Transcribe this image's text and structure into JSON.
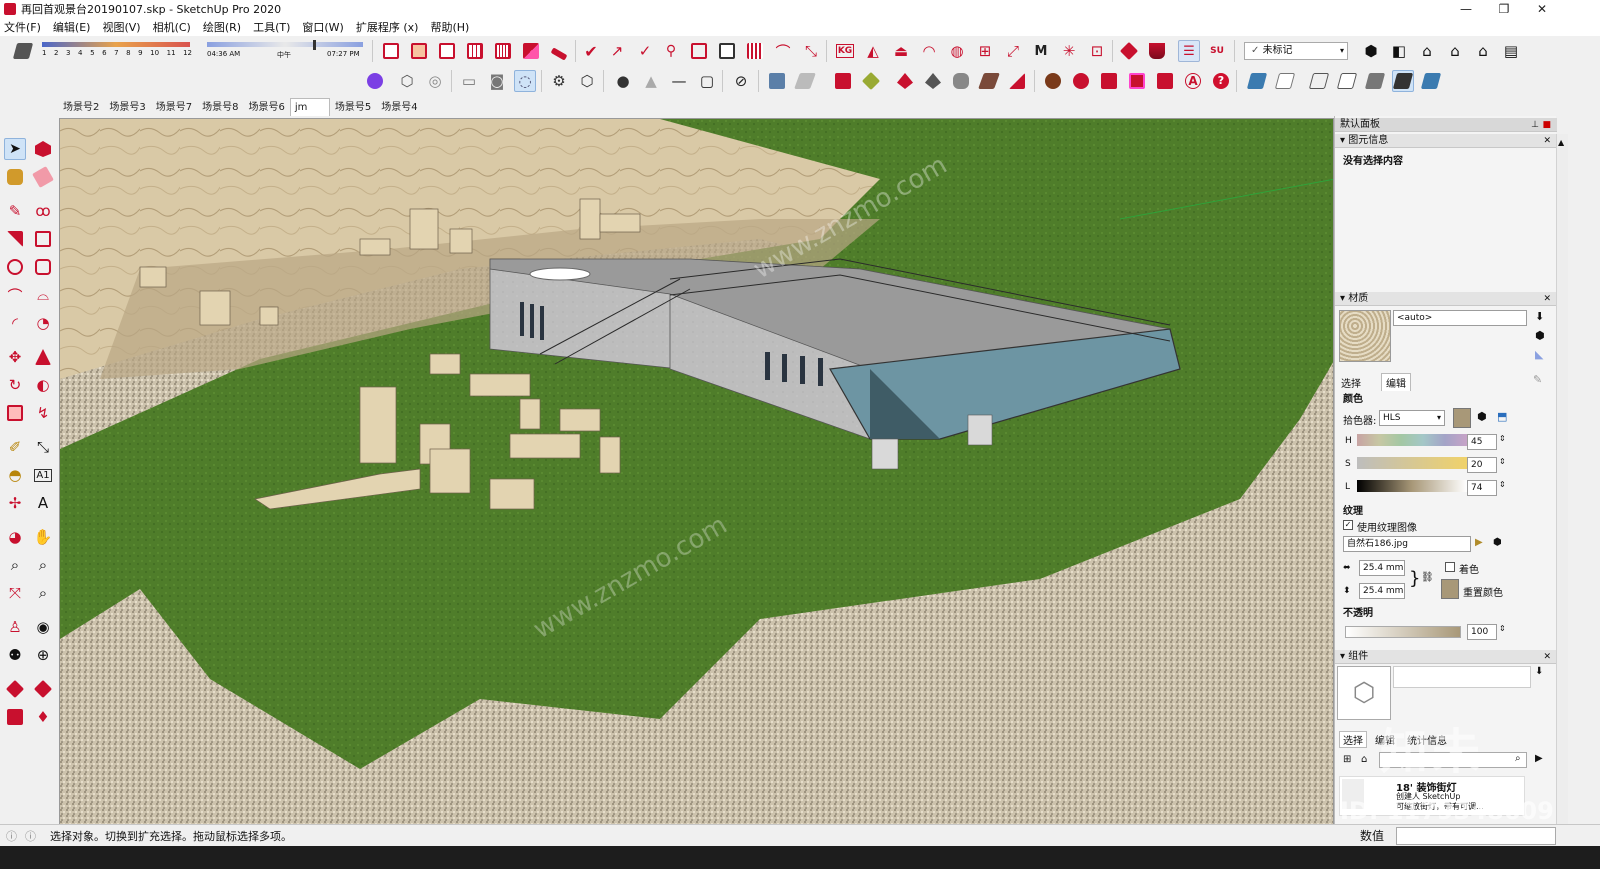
{
  "window": {
    "title": "再回首观景台20190107.skp - SketchUp Pro 2020",
    "minimize": "—",
    "maximize": "❐",
    "close": "✕"
  },
  "menu": [
    "文件(F)",
    "编辑(E)",
    "视图(V)",
    "相机(C)",
    "绘图(R)",
    "工具(T)",
    "窗口(W)",
    "扩展程序 (x)",
    "帮助(H)"
  ],
  "shadow": {
    "months": [
      "1",
      "2",
      "3",
      "4",
      "5",
      "6",
      "7",
      "8",
      "9",
      "10",
      "11",
      "12"
    ],
    "time_start": "04:36 AM",
    "time_mid": "中午",
    "time_end": "07:27 PM"
  },
  "tag_select": {
    "value": "未标记"
  },
  "scenes": {
    "tabs": [
      "场景号2",
      "场景号3",
      "场景号7",
      "场景号8",
      "场景号6",
      "jm",
      "场景号5",
      "场景号4"
    ],
    "active_index": 5
  },
  "panel": {
    "title": "默认面板",
    "entity_info": {
      "header": "图元信息",
      "none_selected": "没有选择内容"
    },
    "materials": {
      "header": "材质",
      "name_value": "<auto>",
      "tab_select": "选择",
      "tab_edit": "编辑",
      "color_label": "颜色",
      "picker_label": "拾色器:",
      "picker_value": "HLS",
      "swatch_color": "#a89878",
      "h_label": "H",
      "h_value": "45",
      "s_label": "S",
      "s_value": "20",
      "l_label": "L",
      "l_value": "74",
      "texture_label": "纹理",
      "use_texture_label": "使用纹理图像",
      "texture_file": "自然石186.jpg",
      "width_value": "25.4 mm",
      "height_value": "25.4 mm",
      "colorize_label": "着色",
      "reset_color_label": "重置颜色",
      "opacity_label": "不透明",
      "opacity_value": "100"
    },
    "components": {
      "header": "组件",
      "tab_select": "选择",
      "tab_edit": "编辑",
      "tab_stats": "统计信息",
      "item_title": "18' 装饰街灯",
      "item_sub": "创建人 SketchUp",
      "item_desc": "可缩放街灯，带有可调..."
    }
  },
  "status": {
    "text": "选择对象。切换到扩充选择。拖动鼠标选择多项。",
    "measure_label": "数值"
  },
  "watermark": {
    "logo": "知未",
    "id_text": "ID: 1179348609",
    "url": "www.znzmo.com"
  },
  "colors": {
    "grass": "#4f7d2a",
    "rock": "#d8c9a8",
    "gravel": "#c9bfa8",
    "building": "#b9b9b9",
    "glass": "#6d95a3",
    "accent_red": "#c8102e"
  }
}
